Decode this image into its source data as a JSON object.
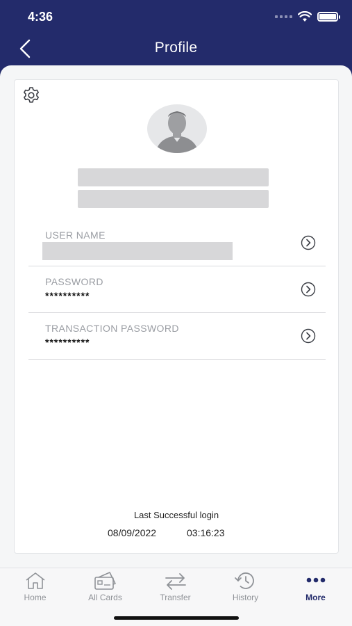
{
  "status_bar": {
    "time": "4:36"
  },
  "header": {
    "title": "Profile"
  },
  "profile": {
    "fields": [
      {
        "label": "USER NAME",
        "value": ""
      },
      {
        "label": "PASSWORD",
        "value": "**********"
      },
      {
        "label": "TRANSACTION PASSWORD",
        "value": "**********"
      }
    ],
    "last_login": {
      "label": "Last Successful login",
      "date": "08/09/2022",
      "time": "03:16:23"
    }
  },
  "tabs": [
    {
      "label": "Home",
      "icon": "home-icon"
    },
    {
      "label": "All Cards",
      "icon": "card-icon"
    },
    {
      "label": "Transfer",
      "icon": "transfer-icon"
    },
    {
      "label": "History",
      "icon": "history-icon"
    },
    {
      "label": "More",
      "icon": "more-icon"
    }
  ],
  "colors": {
    "primary": "#232b6b",
    "tab_inactive": "#8f9297",
    "placeholder": "#d7d7d9"
  }
}
